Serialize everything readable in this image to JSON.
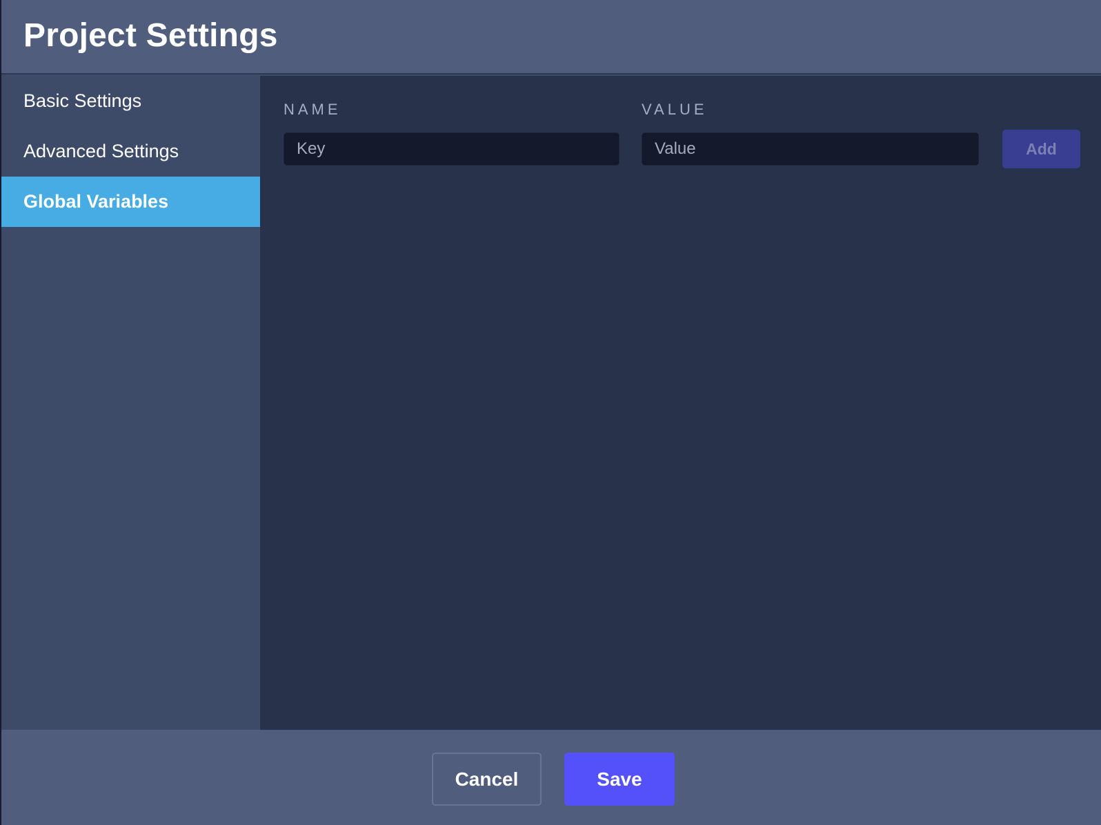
{
  "dialog": {
    "title": "Project Settings"
  },
  "sidebar": {
    "items": [
      {
        "label": "Basic Settings",
        "active": false
      },
      {
        "label": "Advanced Settings",
        "active": false
      },
      {
        "label": "Global Variables",
        "active": true
      }
    ]
  },
  "variables": {
    "name_header": "NAME",
    "value_header": "VALUE",
    "key_input": {
      "value": "",
      "placeholder": "Key"
    },
    "value_input": {
      "value": "",
      "placeholder": "Value"
    },
    "add_label": "Add",
    "add_enabled": false
  },
  "footer": {
    "cancel_label": "Cancel",
    "save_label": "Save"
  },
  "colors": {
    "header_bg": "#505d7d",
    "sidebar_bg": "#3d4a68",
    "content_bg": "#28324b",
    "active_item_bg": "#47ace3",
    "input_bg": "#141a2b",
    "primary_button": "#5551fa",
    "disabled_button": "#3a3e93"
  }
}
